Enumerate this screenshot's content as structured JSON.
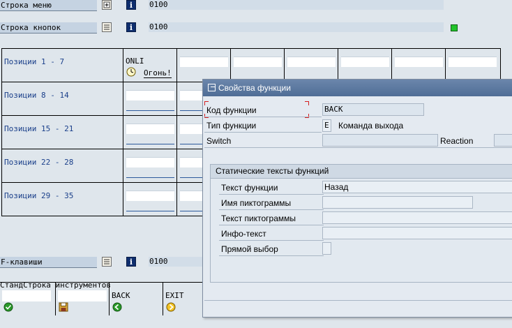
{
  "menu_bar_row": {
    "label": "Строка меню",
    "code": "0100"
  },
  "button_bar_row": {
    "label": "Строка кнопок",
    "code": "0100"
  },
  "positions_grid": {
    "rows": [
      {
        "label": "Позиции  1 -  7"
      },
      {
        "label": "Позиции  8 - 14"
      },
      {
        "label": "Позиции 15 - 21"
      },
      {
        "label": "Позиции 22 - 28"
      },
      {
        "label": "Позиции 29 - 35"
      }
    ],
    "first_cell": {
      "code": "ONLI",
      "text": "Огонь!"
    }
  },
  "fkeys_row": {
    "label": "F-клавиши",
    "code": "0100"
  },
  "std_toolbar": {
    "label": "СтандСтрока инструментов",
    "cells": [
      {
        "code": ""
      },
      {
        "code": ""
      },
      {
        "code": "BACK"
      },
      {
        "code": "EXIT"
      }
    ]
  },
  "dialog": {
    "title": "Свойства функции",
    "function_code_label": "Код функции",
    "function_code_value": "BACK",
    "function_type_label": "Тип функции",
    "function_type_value": "E",
    "function_type_text": "Команда выхода",
    "switch_label": "Switch",
    "reaction_label": "Reaction",
    "static_texts_group": {
      "title": "Статические тексты функций",
      "function_text_label": "Текст функции",
      "function_text_value": "Назад",
      "icon_name_label": "Имя пиктограммы",
      "icon_text_label": "Текст пиктограммы",
      "info_text_label": "Инфо-текст",
      "direct_select_label": "Прямой выбор"
    }
  },
  "colors": {
    "accent_blue": "#1a3f8a",
    "title_bar": "#5674a0",
    "status_green": "#22c32c"
  }
}
